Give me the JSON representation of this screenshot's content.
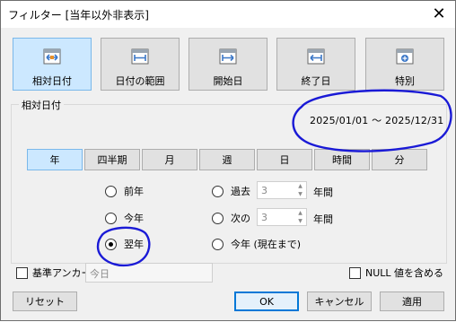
{
  "window": {
    "title": "フィルター [当年以外非表示]",
    "close_glyph": "✕"
  },
  "date_tabs": [
    {
      "label": "相対日付",
      "icon": "relative-date-icon",
      "selected": true
    },
    {
      "label": "日付の範囲",
      "icon": "date-range-icon",
      "selected": false
    },
    {
      "label": "開始日",
      "icon": "start-date-icon",
      "selected": false
    },
    {
      "label": "終了日",
      "icon": "end-date-icon",
      "selected": false
    },
    {
      "label": "特別",
      "icon": "special-icon",
      "selected": false
    }
  ],
  "relative_date": {
    "group_label": "相対日付",
    "range_text": "2025/01/01 ～ 2025/12/31",
    "periods": [
      "年",
      "四半期",
      "月",
      "週",
      "日",
      "時間",
      "分"
    ],
    "selected_period": "年",
    "options_left": [
      {
        "label": "前年",
        "checked": false
      },
      {
        "label": "今年",
        "checked": false
      },
      {
        "label": "翌年",
        "checked": true
      }
    ],
    "option_last": {
      "label": "過去",
      "value": "3",
      "unit": "年間",
      "checked": false
    },
    "option_next": {
      "label": "次の",
      "value": "3",
      "unit": "年間",
      "checked": false
    },
    "option_to_date": {
      "label": "今年 (現在まで)",
      "checked": false
    }
  },
  "anchor": {
    "label": "基準アンカー",
    "checked": false,
    "value": "今日"
  },
  "null_option": {
    "label": "NULL 値を含める",
    "checked": false
  },
  "footer": {
    "reset_label": "リセット",
    "ok_label": "OK",
    "cancel_label": "キャンセル",
    "apply_label": "適用"
  },
  "colors": {
    "selected_fill": "#cce8ff",
    "selected_border": "#7ab8ea",
    "annotation_ink": "#1a1ad6",
    "icon_blue": "#3c78c8"
  }
}
